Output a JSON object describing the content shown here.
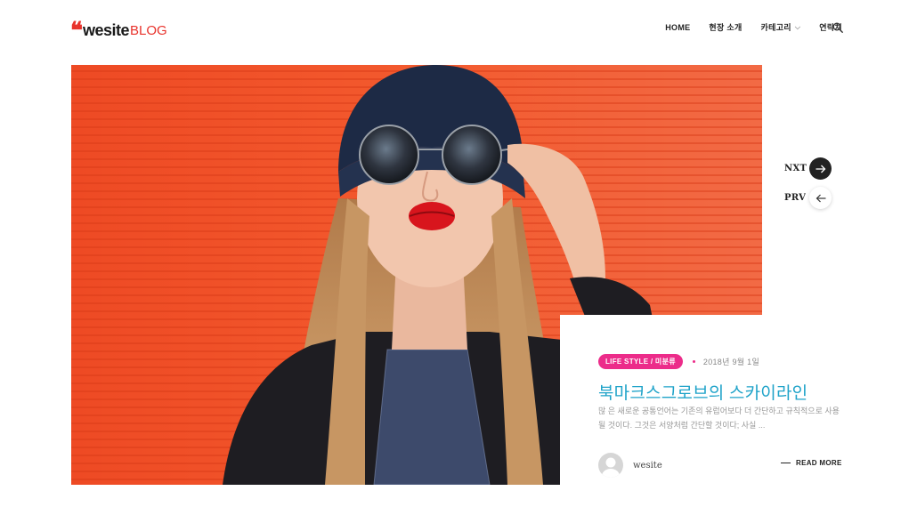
{
  "header": {
    "logo_quote": "❝",
    "logo_brand": "wesite",
    "logo_blog": "BLOG",
    "nav": [
      {
        "label": "HOME"
      },
      {
        "label": "현장 소개"
      },
      {
        "label": "카테고리",
        "has_dropdown": true
      },
      {
        "label": "연락처"
      }
    ],
    "search_icon": "search-icon"
  },
  "slider": {
    "next_label": "NXT",
    "prev_label": "PRV",
    "next_icon": "arrow-right-icon",
    "prev_icon": "arrow-left-icon"
  },
  "post": {
    "category": "LIFE STYLE / 미분류",
    "date": "2018년 9월 1일",
    "title": "북마크스그로브의 스카이라인",
    "excerpt": "많 은 새로운 공통언어는 기존의 유럽어보다 더 간단하고 규칙적으로 사용될 것이다. 그것은 서양처럼 간단할 것이다; 사실 ...",
    "author": "wesite",
    "read_more": "READ MORE"
  },
  "colors": {
    "accent_red": "#e8322b",
    "badge_pink": "#ec2c8a",
    "title_blue": "#1fa3c9",
    "hero_orange": "#f04522"
  }
}
